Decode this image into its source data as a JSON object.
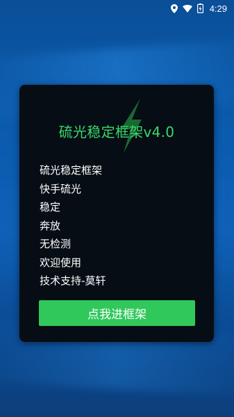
{
  "status_bar": {
    "time": "4:29",
    "icons": [
      "location-icon",
      "wifi-icon",
      "battery-charging-icon"
    ]
  },
  "dialog": {
    "title": "硫光稳定框架v4.0",
    "logo_icon": "lightning-bolt-icon",
    "items": [
      "硫光稳定框架",
      "快手硫光",
      "稳定",
      "奔放",
      "无检测",
      "欢迎使用",
      "技术支持-莫轩"
    ],
    "button_label": "点我进框架"
  },
  "colors": {
    "accent_green": "#30c85b",
    "title_green": "#3ad86a",
    "dialog_bg": "#060d14",
    "background_blue": "#0b5cb0"
  }
}
